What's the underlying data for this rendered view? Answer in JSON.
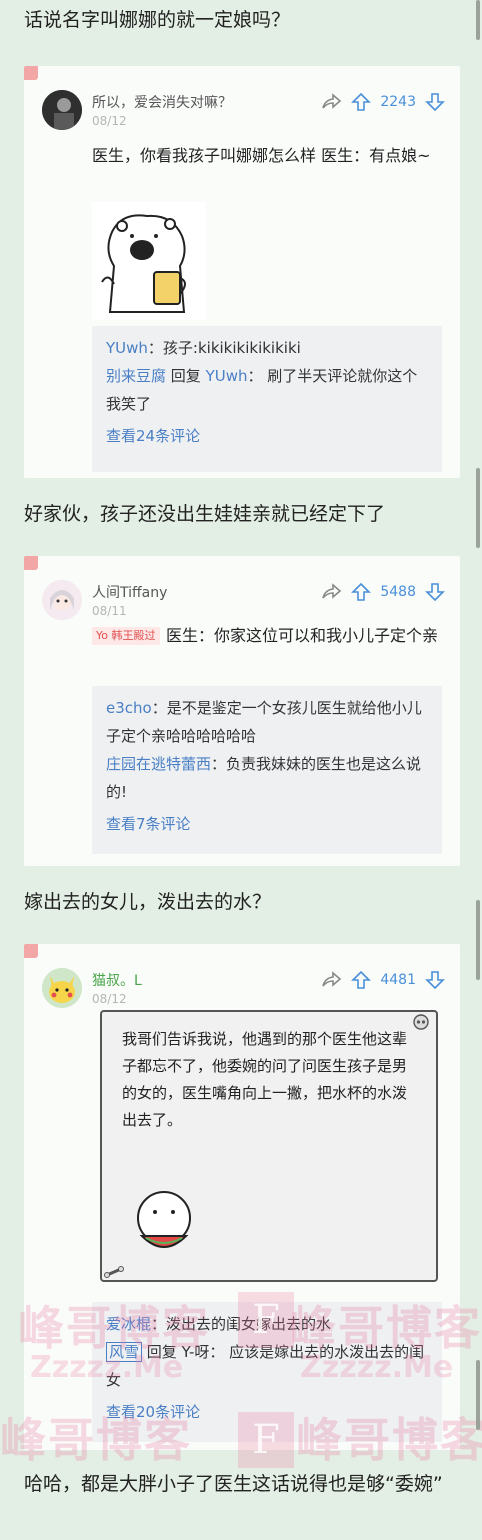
{
  "captions": [
    "话说名字叫娜娜的就一定娘吗？",
    "好家伙，孩子还没出生娃娃亲就已经定下了",
    "嫁出去的女儿，泼出去的水？",
    "哈哈，都是大胖小子了医生这话说得也是够“委婉”"
  ],
  "posts": [
    {
      "username": "所以，爱会消失对嘛？",
      "date": "08/12",
      "votes": "2243",
      "text": "医生，你看我孩子叫娜娜怎么样 医生：有点娘~",
      "replies": [
        {
          "user": "YUwh",
          "text": "：孩子:kikikikikikikiki"
        },
        {
          "user": "别来豆腐",
          "mid": " 回复 ",
          "target": "YUwh",
          "text": "： 刷了半天评论就你这个我笑了"
        }
      ],
      "more": "查看24条评论"
    },
    {
      "username": "人间Tiffany",
      "date": "08/11",
      "votes": "5488",
      "badge": "Yo 韩王殿过",
      "text": "医生：你家这位可以和我小儿子定个亲",
      "replies": [
        {
          "user": "e3cho",
          "text": "：是不是鉴定一个女孩儿医生就给他小儿子定个亲哈哈哈哈哈哈"
        },
        {
          "user": "庄园在逃特蕾西",
          "text": "：负责我妹妹的医生也是这么说的!"
        }
      ],
      "more": "查看7条评论"
    },
    {
      "username": "猫叔。L",
      "date": "08/12",
      "votes": "4481",
      "text": "我哥们告诉我说，他遇到的那个医生他这辈子都忘不了，他委婉的问了问医生孩子是男的女的，医生嘴角向上一撇，把水杯的水泼出去了。",
      "replies": [
        {
          "user": "爱冰棍",
          "text": "：泼出去的闺女嫁出去的水"
        },
        {
          "user": "风雪",
          "mid": " 回复 ",
          "target": "Y-呀",
          "text": "： 应该是嫁出去的水泼出去的闺女"
        }
      ],
      "more": "查看20条评论"
    }
  ],
  "watermark": {
    "main": "峰哥博客",
    "sub": "Zzzzz.Me",
    "letter": "F"
  },
  "colors": {
    "link": "#4a7fc6",
    "vote": "#4a90d9",
    "background": "#e3efe4"
  }
}
